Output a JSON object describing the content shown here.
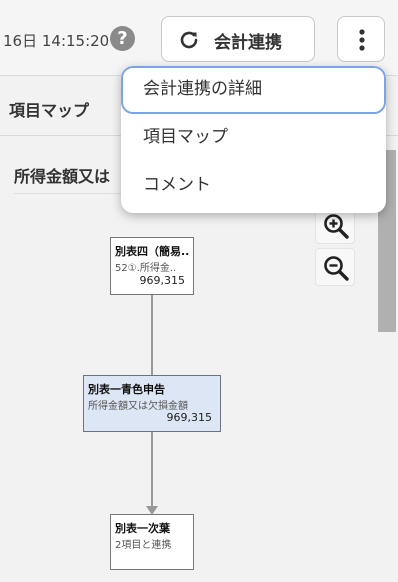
{
  "header": {
    "timestamp": "16日 14:15:20",
    "help_icon_glyph": "?",
    "sync_button_label": "会計連携"
  },
  "panel": {
    "title": "項目マップ",
    "section_title": "所得金額又は"
  },
  "nodes": [
    {
      "title": "別表四（簡易..",
      "subtitle": "52①.所得金..",
      "value": "969,315"
    },
    {
      "title": "別表一青色申告",
      "subtitle": "所得金額又は欠損金額",
      "value": "969,315"
    },
    {
      "title": "別表一次葉",
      "subtitle": "2項目と連携"
    }
  ],
  "menu": {
    "items": [
      {
        "label": "会計連携の詳細",
        "active": true
      },
      {
        "label": "項目マップ"
      },
      {
        "label": "コメント"
      }
    ]
  },
  "colors": {
    "accent_border": "#7aa4e6",
    "highlight_node": "#dde6f5",
    "help_icon": "#8a8a8a"
  },
  "icons": {
    "help": "question-circle-icon",
    "sync": "refresh-icon",
    "more": "more-vertical-icon",
    "zoom_in": "zoom-in-icon",
    "zoom_out": "zoom-out-icon"
  }
}
